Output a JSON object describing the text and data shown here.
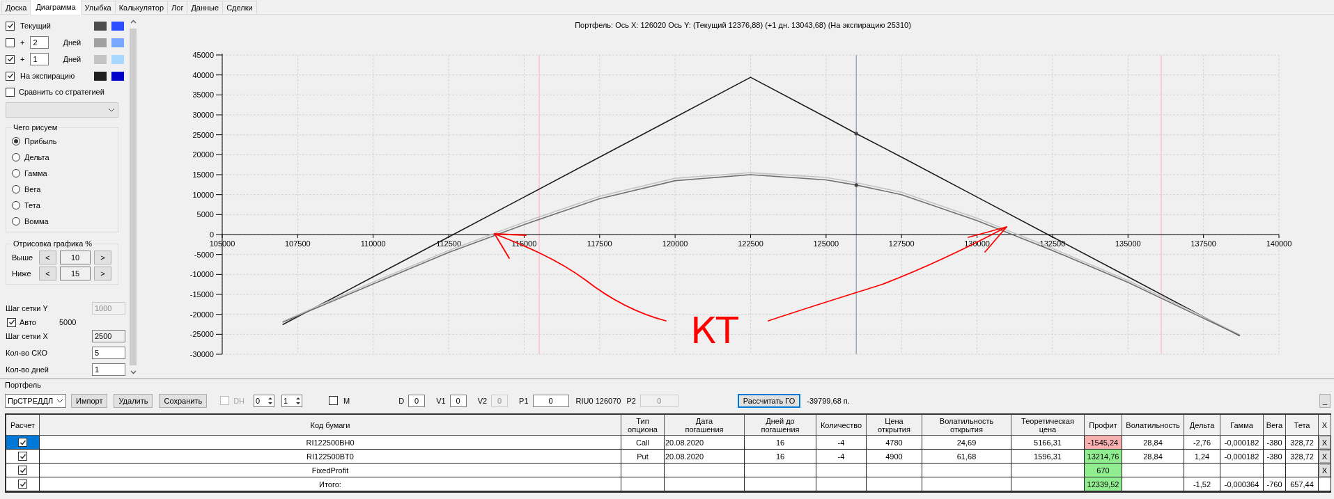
{
  "tabs": [
    {
      "label": "Доска",
      "selected": false
    },
    {
      "label": "Диаграмма",
      "selected": true
    },
    {
      "label": "Улыбка",
      "selected": false
    },
    {
      "label": "Калькулятор",
      "selected": false
    },
    {
      "label": "Лог",
      "selected": false
    },
    {
      "label": "Данные",
      "selected": false
    },
    {
      "label": "Сделки",
      "selected": false
    }
  ],
  "series_options": [
    {
      "kind": "plain",
      "label": "Текущий",
      "checked": true,
      "swatches": [
        {
          "color": "#4d4d4d"
        },
        {
          "color": "#2b4cff"
        }
      ]
    },
    {
      "kind": "days",
      "checked": false,
      "sign": "+",
      "days": "2",
      "unit": "Дней",
      "swatches": [
        {
          "color": "#a0a0a0"
        },
        {
          "color": "#78a8ff"
        }
      ]
    },
    {
      "kind": "days",
      "checked": true,
      "sign": "+",
      "days": "1",
      "unit": "Дней",
      "swatches": [
        {
          "color": "#c4c4c4"
        },
        {
          "color": "#a8d8ff"
        }
      ]
    },
    {
      "kind": "plain",
      "label": "На экспирацию",
      "checked": true,
      "swatches": [
        {
          "color": "#1e1e1e"
        },
        {
          "color": "#0000c8"
        }
      ]
    }
  ],
  "compare": {
    "label": "Сравнить со стратегией",
    "checked": false
  },
  "draw_group": {
    "title": "Чего рисуем",
    "options": [
      {
        "label": "Прибыль",
        "selected": true
      },
      {
        "label": "Дельта",
        "selected": false
      },
      {
        "label": "Гамма",
        "selected": false
      },
      {
        "label": "Вега",
        "selected": false
      },
      {
        "label": "Тета",
        "selected": false
      },
      {
        "label": "Вомма",
        "selected": false
      }
    ]
  },
  "range_group": {
    "title": "Отрисовка графика %",
    "rows": [
      {
        "label": "Выше",
        "dec": "<",
        "value": "10",
        "inc": ">"
      },
      {
        "label": "Ниже",
        "dec": "<",
        "value": "15",
        "inc": ">"
      }
    ]
  },
  "settings": [
    {
      "kind": "field",
      "label": "Шаг сетки Y",
      "value": "1000",
      "disabled": true
    },
    {
      "kind": "check",
      "label": "Авто",
      "checked": true,
      "value": "5000"
    },
    {
      "kind": "field",
      "label": "Шаг сетки X",
      "value": "2500",
      "disabled": false
    },
    {
      "kind": "field",
      "label": "Кол-во СКО",
      "value": "5",
      "disabled": false
    },
    {
      "kind": "field",
      "label": "Кол-во дней",
      "value": "1",
      "disabled": false
    }
  ],
  "chart": {
    "title": "Портфель: Ось X: 126020 Ось Y:  (Текущий 12376,88)  (+1 дн. 13043,68)  (На экспирацию 25310)",
    "chart_data": {
      "type": "line",
      "grid": true,
      "x": [
        107000,
        110000,
        112500,
        115000,
        117500,
        120000,
        122500,
        125000,
        126000,
        127500,
        130000,
        132500,
        135000,
        137500,
        138700
      ],
      "series": [
        {
          "color": "#1e1e1e",
          "values": [
            -22600,
            -10600,
            -600,
            9400,
            19400,
            29400,
            39400,
            29400,
            25300,
            19400,
            9400,
            -600,
            -10600,
            -20600,
            -25400
          ]
        },
        {
          "color": "#c4c4c4",
          "values": [
            -21800,
            -11900,
            -4000,
            3100,
            9600,
            14100,
            15500,
            14300,
            13000,
            10600,
            4100,
            -3500,
            -11500,
            -20600,
            -25100
          ]
        },
        {
          "color": "#707070",
          "values": [
            -22000,
            -12400,
            -4500,
            2500,
            9000,
            13500,
            15000,
            13700,
            12400,
            10000,
            3500,
            -4000,
            -12000,
            -21000,
            -25300
          ]
        }
      ],
      "xlim": [
        105000,
        140000
      ],
      "ylim": [
        -30000,
        45000
      ],
      "xticks": [
        105000,
        107500,
        110000,
        112500,
        115000,
        117500,
        120000,
        122500,
        125000,
        127500,
        130000,
        132500,
        135000,
        137500,
        140000
      ],
      "yticks": [
        -30000,
        -25000,
        -20000,
        -15000,
        -10000,
        -5000,
        0,
        5000,
        10000,
        15000,
        20000,
        25000,
        30000,
        35000,
        40000,
        45000
      ],
      "ref_lines": [
        {
          "axis": "x",
          "value": 115500,
          "color": "#ffb6c1"
        },
        {
          "axis": "x",
          "value": 136100,
          "color": "#ffb6c1"
        },
        {
          "axis": "x",
          "value": 126000,
          "color": "#8898b0"
        }
      ],
      "annotations": [
        "КТ"
      ]
    }
  },
  "portfolio": {
    "title": "Портфель",
    "strategy": "ПрСТРЕДДЛ",
    "buttons": [
      "Импорт",
      "Удалить",
      "Сохранить"
    ],
    "dh": {
      "label": "DH",
      "checked": false,
      "disabled": true
    },
    "spinners": [
      "0",
      "1"
    ],
    "m": {
      "label": "M",
      "checked": false
    },
    "params": [
      {
        "label": "D",
        "value": "0",
        "disabled": false
      },
      {
        "label": "V1",
        "value": "0",
        "disabled": false
      },
      {
        "label": "V2",
        "value": "0",
        "disabled": true
      },
      {
        "label": "P1",
        "value": "0",
        "disabled": false
      }
    ],
    "underlying": "RIU0 126070",
    "p2": {
      "label": "P2",
      "value": "0",
      "disabled": true
    },
    "calc_button": "Рассчитать ГО",
    "margin": "-39799,68 п.",
    "minimize_button": "_"
  },
  "table": {
    "columns": [
      "Расчет",
      "Код бумаги",
      "Тип\nопциона",
      "Дата\nпогашения",
      "Дней до\nпогашения",
      "Количество",
      "Цена\nоткрытия",
      "Волатильность\nоткрытия",
      "Теоретическая\nцена",
      "Профит",
      "Волатильность",
      "Дельта",
      "Гамма",
      "Вега",
      "Тета",
      "X"
    ],
    "rows": [
      {
        "selected": true,
        "checked": true,
        "cells": [
          "",
          "RI122500BH0",
          "Call",
          "20.08.2020",
          "16",
          "-4",
          "4780",
          "24,69",
          "5166,31",
          {
            "text": "-1545,24",
            "color": "#f7b0b0"
          },
          "28,84",
          "-2,76",
          "-0,000182",
          "-380",
          "328,72",
          "X"
        ]
      },
      {
        "selected": false,
        "checked": true,
        "cells": [
          "",
          "RI122500BT0",
          "Put",
          "20.08.2020",
          "16",
          "-4",
          "4900",
          "61,68",
          "1596,31",
          {
            "text": "13214,76",
            "color": "#90ee90"
          },
          "28,84",
          "1,24",
          "-0,000182",
          "-380",
          "328,72",
          "X"
        ]
      },
      {
        "selected": false,
        "checked": true,
        "cells": [
          "",
          "FixedProfit",
          "",
          "",
          "",
          "",
          "",
          "",
          "",
          {
            "text": "670",
            "color": "#90ee90"
          },
          "",
          "",
          "",
          "",
          "",
          "X"
        ]
      },
      {
        "selected": false,
        "checked": true,
        "cells": [
          "",
          "Итого:",
          "",
          "",
          "",
          "",
          "",
          "",
          "",
          {
            "text": "12339,52",
            "color": "#90ee90"
          },
          "",
          "-1,52",
          "-0,000364",
          "-760",
          "657,44",
          ""
        ]
      }
    ]
  }
}
